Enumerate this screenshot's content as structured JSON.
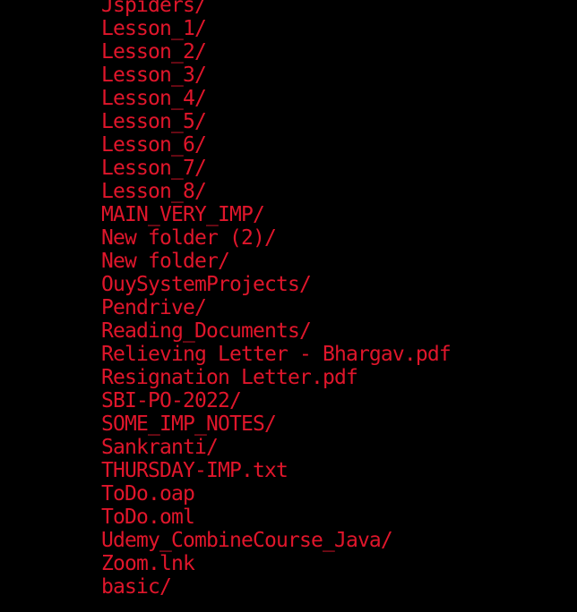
{
  "terminal": {
    "text_color": "#e0162b",
    "background_color": "#000000",
    "entries": [
      "Jspiders/",
      "Lesson_1/",
      "Lesson_2/",
      "Lesson_3/",
      "Lesson_4/",
      "Lesson_5/",
      "Lesson_6/",
      "Lesson_7/",
      "Lesson_8/",
      "MAIN_VERY_IMP/",
      "New folder (2)/",
      "New folder/",
      "OuySystemProjects/",
      "Pendrive/",
      "Reading_Documents/",
      "Relieving Letter - Bhargav.pdf",
      "Resignation Letter.pdf",
      "SBI-PO-2022/",
      "SOME_IMP_NOTES/",
      "Sankranti/",
      "THURSDAY-IMP.txt",
      "ToDo.oap",
      "ToDo.oml",
      "Udemy_CombineCourse_Java/",
      "Zoom.lnk",
      "basic/"
    ]
  }
}
